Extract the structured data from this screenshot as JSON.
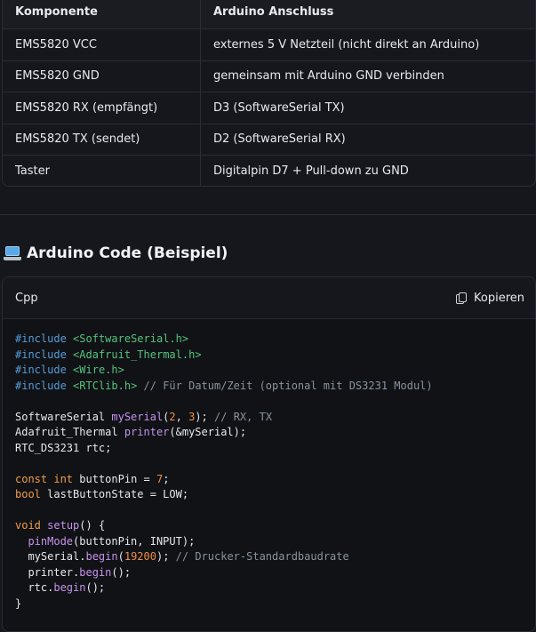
{
  "table": {
    "headers": [
      "Komponente",
      "Arduino Anschluss"
    ],
    "rows": [
      [
        "EMS5820 VCC",
        "externes 5 V Netzteil (nicht direkt an Arduino)"
      ],
      [
        "EMS5820 GND",
        "gemeinsam mit Arduino GND verbinden"
      ],
      [
        "EMS5820 RX (empfängt)",
        "D3 (SoftwareSerial TX)"
      ],
      [
        "EMS5820 TX (sendet)",
        "D2 (SoftwareSerial RX)"
      ],
      [
        "Taster",
        "Digitalpin D7 + Pull-down zu GND"
      ]
    ]
  },
  "section": {
    "icon": "laptop-icon",
    "title": "Arduino Code (Beispiel)"
  },
  "code_block": {
    "language": "Cpp",
    "copy_label": "Kopieren",
    "lines": [
      [
        {
          "t": "#",
          "c": "kw"
        },
        {
          "t": "include",
          "c": "kw"
        },
        {
          "t": " ",
          "c": "tx"
        },
        {
          "t": "<SoftwareSerial.h>",
          "c": "inc"
        }
      ],
      [
        {
          "t": "#",
          "c": "kw"
        },
        {
          "t": "include",
          "c": "kw"
        },
        {
          "t": " ",
          "c": "tx"
        },
        {
          "t": "<Adafruit_Thermal.h>",
          "c": "inc"
        }
      ],
      [
        {
          "t": "#",
          "c": "kw"
        },
        {
          "t": "include",
          "c": "kw"
        },
        {
          "t": " ",
          "c": "tx"
        },
        {
          "t": "<Wire.h>",
          "c": "inc"
        }
      ],
      [
        {
          "t": "#",
          "c": "kw"
        },
        {
          "t": "include",
          "c": "kw"
        },
        {
          "t": " ",
          "c": "tx"
        },
        {
          "t": "<RTClib.h>",
          "c": "inc"
        },
        {
          "t": " // Für Datum/Zeit (optional mit DS3231 Modul)",
          "c": "cm"
        }
      ],
      [],
      [
        {
          "t": "SoftwareSerial ",
          "c": "tx"
        },
        {
          "t": "mySerial",
          "c": "fn"
        },
        {
          "t": "(",
          "c": "tx"
        },
        {
          "t": "2",
          "c": "num"
        },
        {
          "t": ", ",
          "c": "tx"
        },
        {
          "t": "3",
          "c": "num"
        },
        {
          "t": "); ",
          "c": "tx"
        },
        {
          "t": "// RX, TX",
          "c": "cm"
        }
      ],
      [
        {
          "t": "Adafruit_Thermal ",
          "c": "tx"
        },
        {
          "t": "printer",
          "c": "fn"
        },
        {
          "t": "(&mySerial);",
          "c": "tx"
        }
      ],
      [
        {
          "t": "RTC_DS3231 rtc;",
          "c": "tx"
        }
      ],
      [],
      [
        {
          "t": "const",
          "c": "type"
        },
        {
          "t": " ",
          "c": "tx"
        },
        {
          "t": "int",
          "c": "type"
        },
        {
          "t": " buttonPin = ",
          "c": "tx"
        },
        {
          "t": "7",
          "c": "num"
        },
        {
          "t": ";",
          "c": "tx"
        }
      ],
      [
        {
          "t": "bool",
          "c": "type"
        },
        {
          "t": " lastButtonState = LOW;",
          "c": "tx"
        }
      ],
      [],
      [
        {
          "t": "void",
          "c": "type"
        },
        {
          "t": " ",
          "c": "tx"
        },
        {
          "t": "setup",
          "c": "fn"
        },
        {
          "t": "() {",
          "c": "tx"
        }
      ],
      [
        {
          "t": "  ",
          "c": "tx"
        },
        {
          "t": "pinMode",
          "c": "fn"
        },
        {
          "t": "(buttonPin, INPUT);",
          "c": "tx"
        }
      ],
      [
        {
          "t": "  mySerial.",
          "c": "tx"
        },
        {
          "t": "begin",
          "c": "fn"
        },
        {
          "t": "(",
          "c": "tx"
        },
        {
          "t": "19200",
          "c": "num"
        },
        {
          "t": "); ",
          "c": "tx"
        },
        {
          "t": "// Drucker-Standardbaudrate",
          "c": "cm"
        }
      ],
      [
        {
          "t": "  printer.",
          "c": "tx"
        },
        {
          "t": "begin",
          "c": "fn"
        },
        {
          "t": "();",
          "c": "tx"
        }
      ],
      [
        {
          "t": "  rtc.",
          "c": "tx"
        },
        {
          "t": "begin",
          "c": "fn"
        },
        {
          "t": "();",
          "c": "tx"
        }
      ],
      [
        {
          "t": "}",
          "c": "tx"
        }
      ]
    ]
  },
  "colors": {
    "background": "#15171c",
    "keyword": "#569cd6",
    "include_path": "#57c27c",
    "comment": "#8a93a0",
    "function": "#c792ea",
    "number": "#f08d49"
  }
}
